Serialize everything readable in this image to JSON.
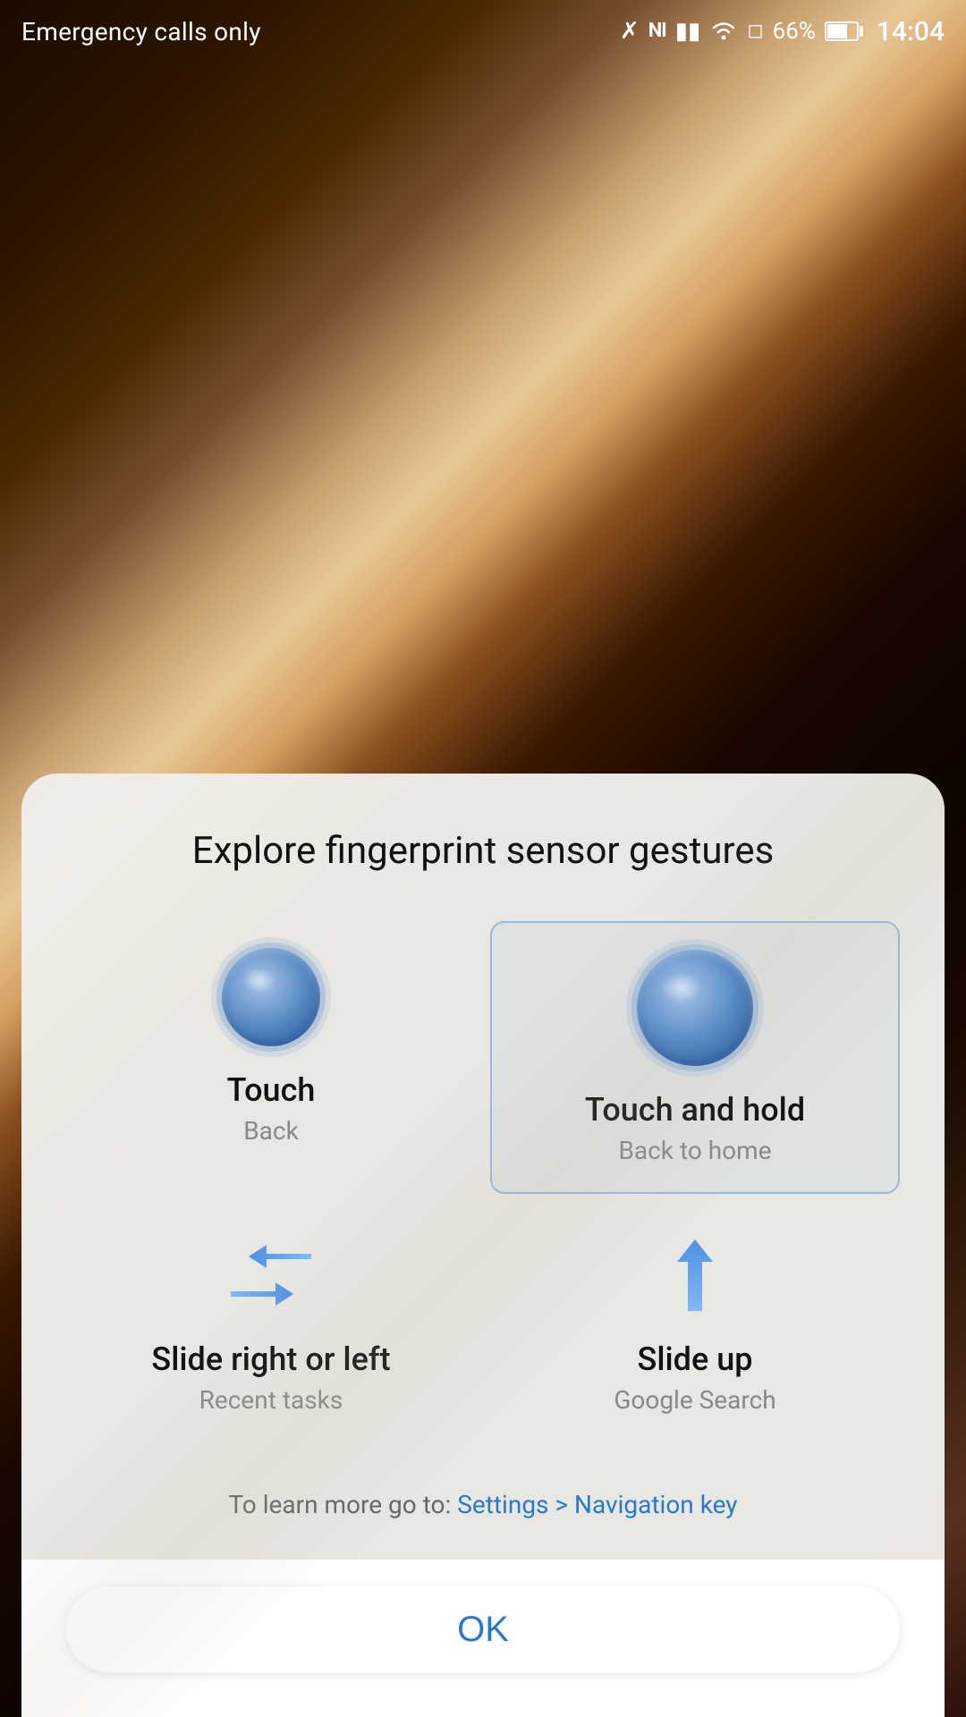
{
  "statusBar": {
    "emergencyText": "Emergency calls only",
    "batteryPercent": "66%",
    "time": "14:04"
  },
  "dialog": {
    "title": "Explore fingerprint sensor gestures",
    "gestures": [
      {
        "id": "touch",
        "label": "Touch",
        "sublabel": "Back",
        "selected": false,
        "iconType": "fingerprint-circle"
      },
      {
        "id": "touch-hold",
        "label": "Touch and hold",
        "sublabel": "Back to home",
        "selected": true,
        "iconType": "fingerprint-circle-large"
      },
      {
        "id": "slide-lr",
        "label": "Slide right or left",
        "sublabel": "Recent tasks",
        "selected": false,
        "iconType": "arrows-lr"
      },
      {
        "id": "slide-up",
        "label": "Slide up",
        "sublabel": "Google Search",
        "selected": false,
        "iconType": "arrow-up"
      }
    ],
    "footerText": "To learn more go to:",
    "footerLink": "Settings > Navigation key",
    "okLabel": "OK"
  }
}
